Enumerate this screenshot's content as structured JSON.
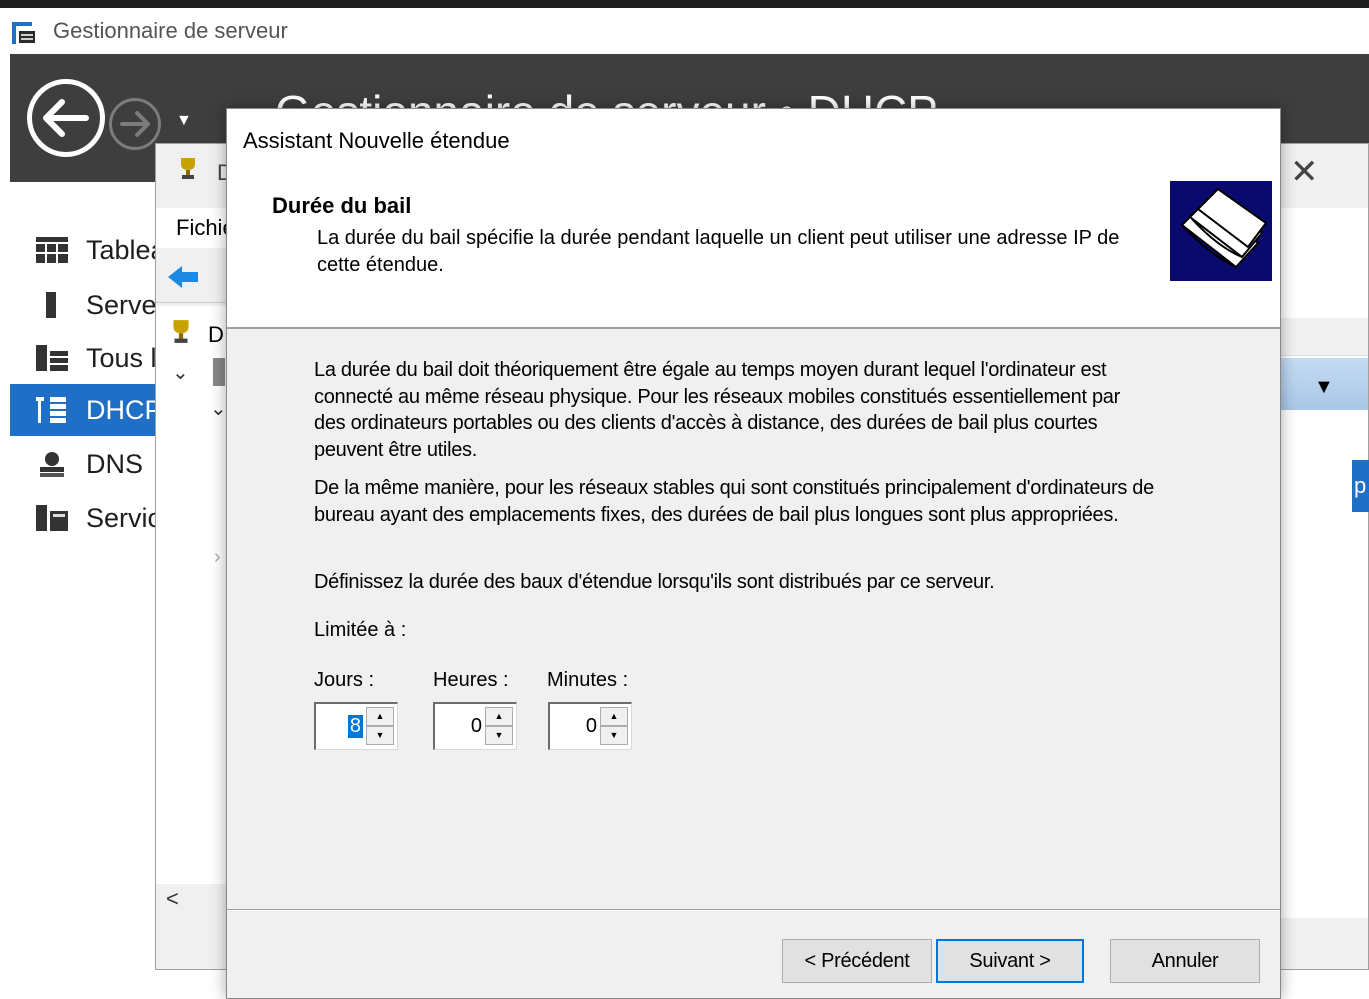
{
  "server_manager": {
    "title": "Gestionnaire de serveur",
    "header_title": "Gestionnaire de serveur • DHCP",
    "nav": [
      {
        "label": "Tableau de bord",
        "icon": "dashboard-icon"
      },
      {
        "label": "Serveur local",
        "icon": "server-icon"
      },
      {
        "label": "Tous les serveurs",
        "icon": "servers-icon"
      },
      {
        "label": "DHCP",
        "icon": "dhcp-icon",
        "active": true
      },
      {
        "label": "DNS",
        "icon": "dns-icon"
      },
      {
        "label": "Services de fichiers",
        "icon": "file-services-icon"
      }
    ]
  },
  "dhcp_console": {
    "title_initial": "D",
    "menu_file": "Fichier",
    "tree_root": "D",
    "actions_edge_text": "p",
    "scroll_left": "<",
    "close_glyph": "✕"
  },
  "wizard": {
    "title": "Assistant Nouvelle étendue",
    "header": {
      "title": "Durée du bail",
      "subtitle": "La durée du bail spécifie la durée pendant laquelle un client peut utiliser une adresse IP de cette étendue."
    },
    "paragraphs": [
      "La durée du bail doit théoriquement être égale au temps moyen durant lequel l'ordinateur est connecté au même réseau physique. Pour les réseaux mobiles constitués essentiellement par des ordinateurs portables ou des clients d'accès à distance, des durées de bail plus courtes peuvent être utiles.",
      "De la même manière, pour les réseaux stables qui sont constitués principalement d'ordinateurs de bureau ayant des emplacements fixes, des durées de bail plus longues sont plus appropriées.",
      "Définissez la durée des baux d'étendue lorsqu'ils sont distribués par ce serveur."
    ],
    "limit_label": "Limitée à :",
    "days_label": "Jours :",
    "days_value": "8",
    "hours_label": "Heures :",
    "hours_value": "0",
    "minutes_label": "Minutes :",
    "minutes_value": "0",
    "buttons": {
      "prev": "< Précédent",
      "next": "Suivant >",
      "cancel": "Annuler"
    }
  },
  "colors": {
    "accent": "#1e6fc5",
    "header_dark": "#3e3e3e",
    "dialog_bg": "#f0f0f0",
    "focus_blue": "#0078d7"
  }
}
